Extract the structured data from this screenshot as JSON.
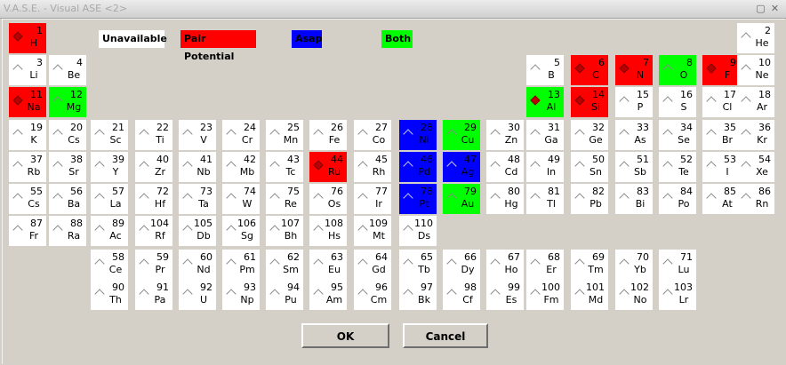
{
  "window": {
    "title": "V.A.S.E. - Visual ASE <2>"
  },
  "legend": [
    {
      "label": "Unavailable",
      "color": "#ffffff",
      "textColor": "#000000"
    },
    {
      "label": "Pair Potential",
      "color": "#ff0000",
      "textColor": "#000000"
    },
    {
      "label": "Asap",
      "color": "#0000ff",
      "textColor": "#000000"
    },
    {
      "label": "Both",
      "color": "#00ff00",
      "textColor": "#000000"
    }
  ],
  "colors": {
    "pair": "#ff0000",
    "asap": "#0000ff",
    "both": "#00ff00",
    "none": "#ffffff"
  },
  "elements": [
    {
      "n": "1",
      "s": "H",
      "r": 0,
      "c": 0,
      "t": "pair",
      "sel": true
    },
    {
      "n": "2",
      "s": "He",
      "r": 0,
      "c": 17
    },
    {
      "n": "3",
      "s": "Li",
      "r": 1,
      "c": 0
    },
    {
      "n": "4",
      "s": "Be",
      "r": 1,
      "c": 1
    },
    {
      "n": "5",
      "s": "B",
      "r": 1,
      "c": 12
    },
    {
      "n": "6",
      "s": "C",
      "r": 1,
      "c": 13,
      "t": "pair",
      "sel": true
    },
    {
      "n": "7",
      "s": "N",
      "r": 1,
      "c": 14,
      "t": "pair",
      "sel": true
    },
    {
      "n": "8",
      "s": "O",
      "r": 1,
      "c": 15,
      "t": "both"
    },
    {
      "n": "9",
      "s": "F",
      "r": 1,
      "c": 16,
      "t": "pair",
      "sel": true
    },
    {
      "n": "10",
      "s": "Ne",
      "r": 1,
      "c": 17
    },
    {
      "n": "11",
      "s": "Na",
      "r": 2,
      "c": 0,
      "t": "pair",
      "sel": true
    },
    {
      "n": "12",
      "s": "Mg",
      "r": 2,
      "c": 1,
      "t": "both"
    },
    {
      "n": "13",
      "s": "Al",
      "r": 2,
      "c": 12,
      "t": "both",
      "sel": true,
      "diamond": true
    },
    {
      "n": "14",
      "s": "Si",
      "r": 2,
      "c": 13,
      "t": "pair",
      "sel": true
    },
    {
      "n": "15",
      "s": "P",
      "r": 2,
      "c": 14
    },
    {
      "n": "16",
      "s": "S",
      "r": 2,
      "c": 15
    },
    {
      "n": "17",
      "s": "Cl",
      "r": 2,
      "c": 16
    },
    {
      "n": "18",
      "s": "Ar",
      "r": 2,
      "c": 17
    },
    {
      "n": "19",
      "s": "K",
      "r": 3,
      "c": 0
    },
    {
      "n": "20",
      "s": "Cs",
      "r": 3,
      "c": 1
    },
    {
      "n": "21",
      "s": "Sc",
      "r": 3,
      "c": 2
    },
    {
      "n": "22",
      "s": "Ti",
      "r": 3,
      "c": 3
    },
    {
      "n": "23",
      "s": "V",
      "r": 3,
      "c": 4
    },
    {
      "n": "24",
      "s": "Cr",
      "r": 3,
      "c": 5
    },
    {
      "n": "25",
      "s": "Mn",
      "r": 3,
      "c": 6
    },
    {
      "n": "26",
      "s": "Fe",
      "r": 3,
      "c": 7
    },
    {
      "n": "27",
      "s": "Co",
      "r": 3,
      "c": 8
    },
    {
      "n": "28",
      "s": "Ni",
      "r": 3,
      "c": 9,
      "t": "asap"
    },
    {
      "n": "29",
      "s": "Cu",
      "r": 3,
      "c": 10,
      "t": "both"
    },
    {
      "n": "30",
      "s": "Zn",
      "r": 3,
      "c": 11
    },
    {
      "n": "31",
      "s": "Ga",
      "r": 3,
      "c": 12
    },
    {
      "n": "32",
      "s": "Ge",
      "r": 3,
      "c": 13
    },
    {
      "n": "33",
      "s": "As",
      "r": 3,
      "c": 14
    },
    {
      "n": "34",
      "s": "Se",
      "r": 3,
      "c": 15
    },
    {
      "n": "35",
      "s": "Br",
      "r": 3,
      "c": 16
    },
    {
      "n": "36",
      "s": "Kr",
      "r": 3,
      "c": 17
    },
    {
      "n": "37",
      "s": "Rb",
      "r": 4,
      "c": 0
    },
    {
      "n": "38",
      "s": "Sr",
      "r": 4,
      "c": 1
    },
    {
      "n": "39",
      "s": "Y",
      "r": 4,
      "c": 2
    },
    {
      "n": "40",
      "s": "Zr",
      "r": 4,
      "c": 3
    },
    {
      "n": "41",
      "s": "Nb",
      "r": 4,
      "c": 4
    },
    {
      "n": "42",
      "s": "Mb",
      "r": 4,
      "c": 5
    },
    {
      "n": "43",
      "s": "Tc",
      "r": 4,
      "c": 6
    },
    {
      "n": "44",
      "s": "Ru",
      "r": 4,
      "c": 7,
      "t": "pair",
      "sel": true
    },
    {
      "n": "45",
      "s": "Rh",
      "r": 4,
      "c": 8
    },
    {
      "n": "46",
      "s": "Pd",
      "r": 4,
      "c": 9,
      "t": "asap"
    },
    {
      "n": "47",
      "s": "Ag",
      "r": 4,
      "c": 10,
      "t": "asap"
    },
    {
      "n": "48",
      "s": "Cd",
      "r": 4,
      "c": 11
    },
    {
      "n": "49",
      "s": "In",
      "r": 4,
      "c": 12
    },
    {
      "n": "50",
      "s": "Sn",
      "r": 4,
      "c": 13
    },
    {
      "n": "51",
      "s": "Sb",
      "r": 4,
      "c": 14
    },
    {
      "n": "52",
      "s": "Te",
      "r": 4,
      "c": 15
    },
    {
      "n": "53",
      "s": "I",
      "r": 4,
      "c": 16
    },
    {
      "n": "54",
      "s": "Xe",
      "r": 4,
      "c": 17
    },
    {
      "n": "55",
      "s": "Cs",
      "r": 5,
      "c": 0
    },
    {
      "n": "56",
      "s": "Ba",
      "r": 5,
      "c": 1
    },
    {
      "n": "57",
      "s": "La",
      "r": 5,
      "c": 2
    },
    {
      "n": "72",
      "s": "Hf",
      "r": 5,
      "c": 3
    },
    {
      "n": "73",
      "s": "Ta",
      "r": 5,
      "c": 4
    },
    {
      "n": "74",
      "s": "W",
      "r": 5,
      "c": 5
    },
    {
      "n": "75",
      "s": "Re",
      "r": 5,
      "c": 6
    },
    {
      "n": "76",
      "s": "Os",
      "r": 5,
      "c": 7
    },
    {
      "n": "77",
      "s": "Ir",
      "r": 5,
      "c": 8
    },
    {
      "n": "78",
      "s": "Pt",
      "r": 5,
      "c": 9,
      "t": "asap"
    },
    {
      "n": "79",
      "s": "Au",
      "r": 5,
      "c": 10,
      "t": "both"
    },
    {
      "n": "80",
      "s": "Hg",
      "r": 5,
      "c": 11
    },
    {
      "n": "81",
      "s": "Tl",
      "r": 5,
      "c": 12
    },
    {
      "n": "82",
      "s": "Pb",
      "r": 5,
      "c": 13
    },
    {
      "n": "83",
      "s": "Bi",
      "r": 5,
      "c": 14
    },
    {
      "n": "84",
      "s": "Po",
      "r": 5,
      "c": 15
    },
    {
      "n": "85",
      "s": "At",
      "r": 5,
      "c": 16
    },
    {
      "n": "86",
      "s": "Rn",
      "r": 5,
      "c": 17
    },
    {
      "n": "87",
      "s": "Fr",
      "r": 6,
      "c": 0
    },
    {
      "n": "88",
      "s": "Ra",
      "r": 6,
      "c": 1
    },
    {
      "n": "89",
      "s": "Ac",
      "r": 6,
      "c": 2
    },
    {
      "n": "104",
      "s": "Rf",
      "r": 6,
      "c": 3
    },
    {
      "n": "105",
      "s": "Db",
      "r": 6,
      "c": 4
    },
    {
      "n": "106",
      "s": "Sg",
      "r": 6,
      "c": 5
    },
    {
      "n": "107",
      "s": "Bh",
      "r": 6,
      "c": 6
    },
    {
      "n": "108",
      "s": "Hs",
      "r": 6,
      "c": 7
    },
    {
      "n": "109",
      "s": "Mt",
      "r": 6,
      "c": 8
    },
    {
      "n": "110",
      "s": "Ds",
      "r": 6,
      "c": 9
    },
    {
      "n": "58",
      "s": "Ce",
      "r": 7,
      "c": 2
    },
    {
      "n": "59",
      "s": "Pr",
      "r": 7,
      "c": 3
    },
    {
      "n": "60",
      "s": "Nd",
      "r": 7,
      "c": 4
    },
    {
      "n": "61",
      "s": "Pm",
      "r": 7,
      "c": 5
    },
    {
      "n": "62",
      "s": "Sm",
      "r": 7,
      "c": 6
    },
    {
      "n": "63",
      "s": "Eu",
      "r": 7,
      "c": 7
    },
    {
      "n": "64",
      "s": "Gd",
      "r": 7,
      "c": 8
    },
    {
      "n": "65",
      "s": "Tb",
      "r": 7,
      "c": 9
    },
    {
      "n": "66",
      "s": "Dy",
      "r": 7,
      "c": 10
    },
    {
      "n": "67",
      "s": "Ho",
      "r": 7,
      "c": 11
    },
    {
      "n": "68",
      "s": "Er",
      "r": 7,
      "c": 12
    },
    {
      "n": "69",
      "s": "Tm",
      "r": 7,
      "c": 13
    },
    {
      "n": "70",
      "s": "Yb",
      "r": 7,
      "c": 14
    },
    {
      "n": "71",
      "s": "Lu",
      "r": 7,
      "c": 15
    },
    {
      "n": "90",
      "s": "Th",
      "r": 8,
      "c": 2
    },
    {
      "n": "91",
      "s": "Pa",
      "r": 8,
      "c": 3
    },
    {
      "n": "92",
      "s": "U",
      "r": 8,
      "c": 4
    },
    {
      "n": "93",
      "s": "Np",
      "r": 8,
      "c": 5
    },
    {
      "n": "94",
      "s": "Pu",
      "r": 8,
      "c": 6
    },
    {
      "n": "95",
      "s": "Am",
      "r": 8,
      "c": 7
    },
    {
      "n": "96",
      "s": "Cm",
      "r": 8,
      "c": 8
    },
    {
      "n": "97",
      "s": "Bk",
      "r": 8,
      "c": 9
    },
    {
      "n": "98",
      "s": "Cf",
      "r": 8,
      "c": 10
    },
    {
      "n": "99",
      "s": "Es",
      "r": 8,
      "c": 11
    },
    {
      "n": "100",
      "s": "Fm",
      "r": 8,
      "c": 12
    },
    {
      "n": "101",
      "s": "Md",
      "r": 8,
      "c": 13
    },
    {
      "n": "102",
      "s": "No",
      "r": 8,
      "c": 14
    },
    {
      "n": "103",
      "s": "Lr",
      "r": 8,
      "c": 15
    }
  ],
  "buttons": {
    "ok": "OK",
    "cancel": "Cancel"
  }
}
